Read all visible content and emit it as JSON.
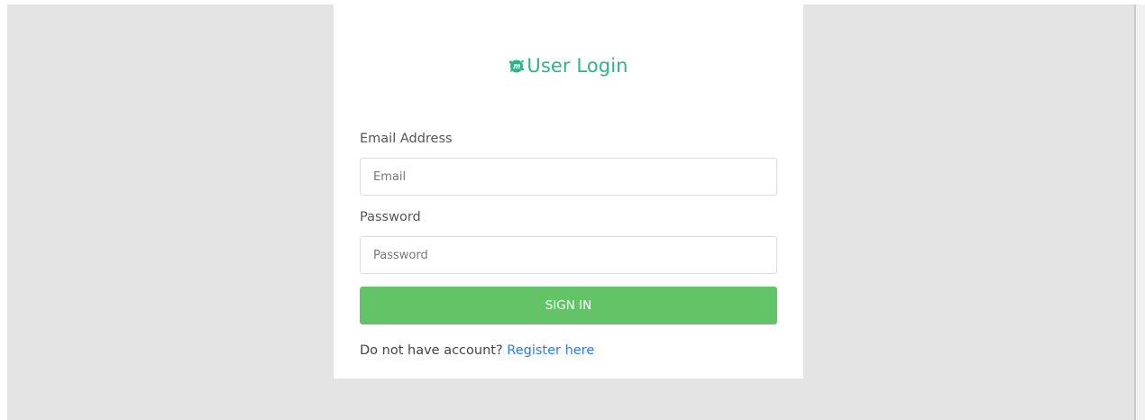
{
  "login": {
    "title": "User Login",
    "logo_icon": "m-splash-logo-icon",
    "email": {
      "label": "Email Address",
      "placeholder": "Email",
      "value": ""
    },
    "password": {
      "label": "Password",
      "placeholder": "Password",
      "value": ""
    },
    "signin_label": "SIGN IN",
    "register_prompt": "Do not have account?",
    "register_link": "Register here"
  },
  "colors": {
    "page_background": "#e4e4e4",
    "card_background": "#ffffff",
    "title": "#2bb58f",
    "signin_button": "#62c466",
    "link": "#2a7de1"
  }
}
